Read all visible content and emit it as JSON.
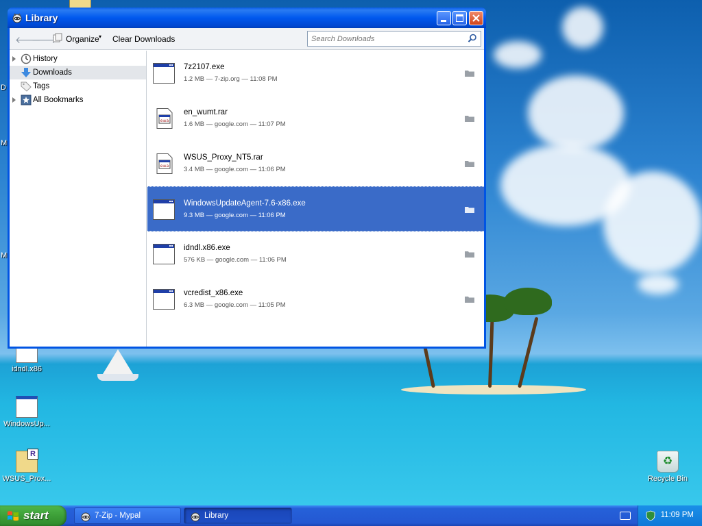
{
  "window": {
    "title": "Library",
    "toolbar": {
      "organize_label": "Organize",
      "clear_downloads_label": "Clear Downloads",
      "search_placeholder": "Search Downloads"
    },
    "sidebar": {
      "items": [
        {
          "label": "History"
        },
        {
          "label": "Downloads"
        },
        {
          "label": "Tags"
        },
        {
          "label": "All Bookmarks"
        }
      ]
    },
    "downloads": [
      {
        "name": "7z2107.exe",
        "meta": "1.2 MB — 7-zip.org — 11:08 PM"
      },
      {
        "name": "en_wumt.rar",
        "meta": "1.6 MB — google.com — 11:07 PM"
      },
      {
        "name": "WSUS_Proxy_NT5.rar",
        "meta": "3.4 MB — google.com — 11:06 PM"
      },
      {
        "name": "WindowsUpdateAgent-7.6-x86.exe",
        "meta": "9.3 MB — google.com — 11:06 PM"
      },
      {
        "name": "idndl.x86.exe",
        "meta": "576 KB — google.com — 11:06 PM"
      },
      {
        "name": "vcredist_x86.exe",
        "meta": "6.3 MB — google.com — 11:05 PM"
      }
    ]
  },
  "desktop": {
    "icons": [
      {
        "label": "idndl.x86"
      },
      {
        "label": "WindowsUp..."
      },
      {
        "label": "WSUS_Prox..."
      },
      {
        "label": "Recycle Bin"
      }
    ],
    "edge_letters": [
      "D",
      "M",
      "M"
    ]
  },
  "taskbar": {
    "start_label": "start",
    "tasks": [
      {
        "label": "7-Zip - Mypal"
      },
      {
        "label": "Library"
      }
    ],
    "clock": "11:09 PM"
  },
  "colors": {
    "title_bar": "#0054e3",
    "selection": "#3a6bc8",
    "start_button": "#3d9f38",
    "taskbar": "#2458d2"
  }
}
